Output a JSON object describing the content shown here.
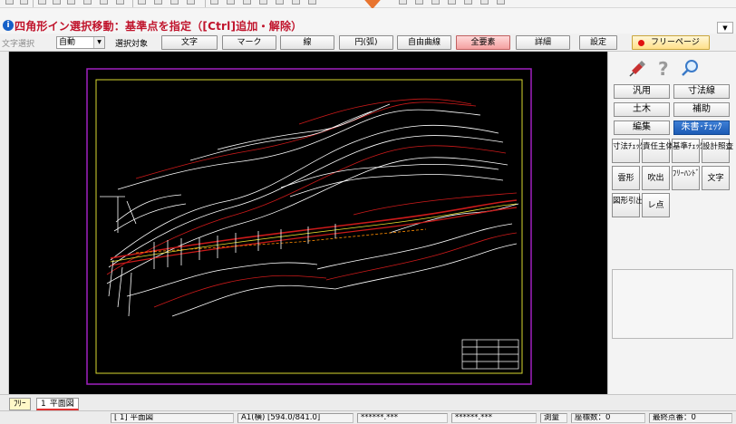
{
  "title": "四角形イン選択移動：基準点を指定（[Ctrl]追加・解除）",
  "filter": {
    "text_select_label": "文字選択",
    "text_select_value": "自動",
    "target_label": "選択対象",
    "buttons": [
      "文字",
      "マーク",
      "線",
      "円(弧)",
      "自由曲線",
      "全要素",
      "詳細"
    ],
    "active_button": "全要素",
    "settings_label": "設定",
    "free_page_label": "フリーページ"
  },
  "palette": {
    "icons": [
      "pin-icon",
      "help-icon",
      "zoom-icon"
    ],
    "rows": [
      [
        "汎用",
        "寸法線"
      ],
      [
        "土木",
        "補助"
      ],
      [
        "編集",
        "朱書･ﾁｪｯｸ"
      ]
    ],
    "active_button": "朱書･ﾁｪｯｸ",
    "tools": [
      [
        "寸法ﾁｪｯｸ",
        "責任主体",
        "基準ﾁｪｯｸ",
        "設計照査"
      ],
      [
        "雲形",
        "吹出",
        "ﾌﾘｰﾊﾝﾄﾞ",
        "文字"
      ],
      [
        "図形引出",
        "レ点"
      ]
    ]
  },
  "sheet_tabs": {
    "free_tab": "ﾌﾘｰ",
    "current_number": "1",
    "current_name": "平面図"
  },
  "status": {
    "sheet": "[ 1] 平面図",
    "paper": "A1(横) [594.0/841.0]",
    "coord_x": "******.***",
    "coord_y": "******.***",
    "mode": "測量",
    "coord_count": "座標数：0",
    "final_point": "最終点番：0"
  },
  "colors": {
    "title_red": "#c0142c",
    "active_pink": "#f4a0a0",
    "palette_blue": "#1c5bb5",
    "canvas_bg": "#000000",
    "frame_magenta": "#a020c0",
    "frame_yellow": "#d8d830"
  }
}
